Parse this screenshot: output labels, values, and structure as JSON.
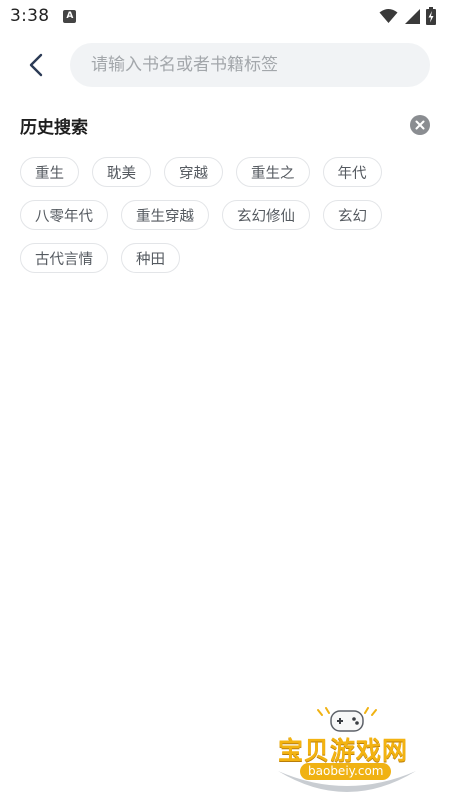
{
  "status_bar": {
    "time": "3:38",
    "notification_letter": "A",
    "icons": [
      "wifi-icon",
      "signal-icon",
      "battery-icon"
    ]
  },
  "search": {
    "placeholder": "请输入书名或者书籍标签",
    "value": ""
  },
  "history": {
    "title": "历史搜索",
    "rows": [
      [
        "重生",
        "耽美",
        "穿越",
        "重生之",
        "年代"
      ],
      [
        "八零年代",
        "重生穿越",
        "玄幻修仙",
        "玄幻"
      ],
      [
        "古代言情",
        "种田"
      ]
    ]
  },
  "watermark": {
    "title": "宝贝游戏网",
    "url": "baobeiy.com"
  },
  "colors": {
    "search_bg": "#f1f3f5",
    "tag_border": "#e3e5e8",
    "tag_text": "#555a60",
    "clear_icon_bg": "#8a8d91",
    "watermark_gold": "#f3b311"
  }
}
